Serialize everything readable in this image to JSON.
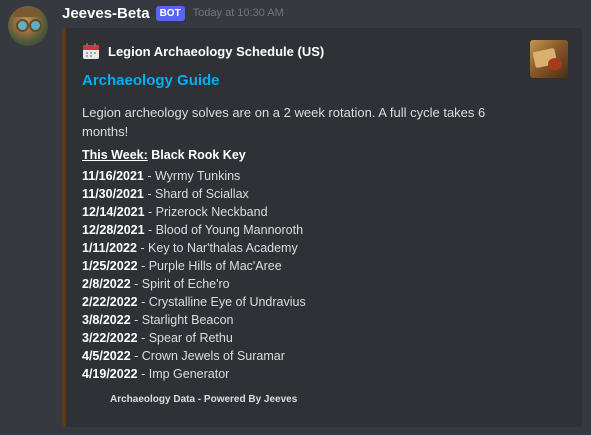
{
  "message": {
    "username": "Jeeves-Beta",
    "bot_tag": "BOT",
    "timestamp": "Today at 10:30 AM"
  },
  "embed": {
    "author_icon": "calendar-icon",
    "author_name": "Legion Archaeology Schedule (US)",
    "title": "Archaeology Guide",
    "description": "Legion archeology solves are on a 2 week rotation. A full cycle takes 6 months!",
    "this_week_label": "This Week:",
    "this_week_value": "Black Rook Key",
    "schedule": [
      {
        "date": "11/16/2021",
        "item": "Wyrmy Tunkins"
      },
      {
        "date": "11/30/2021",
        "item": "Shard of Sciallax"
      },
      {
        "date": "12/14/2021",
        "item": "Prizerock Neckband"
      },
      {
        "date": "12/28/2021",
        "item": "Blood of Young Mannoroth"
      },
      {
        "date": "1/11/2022",
        "item": "Key to Nar'thalas Academy"
      },
      {
        "date": "1/25/2022",
        "item": "Purple Hills of Mac'Aree"
      },
      {
        "date": "2/8/2022",
        "item": "Spirit of Eche'ro"
      },
      {
        "date": "2/22/2022",
        "item": "Crystalline Eye of Undravius"
      },
      {
        "date": "3/8/2022",
        "item": "Starlight Beacon"
      },
      {
        "date": "3/22/2022",
        "item": "Spear of Rethu"
      },
      {
        "date": "4/5/2022",
        "item": "Crown Jewels of Suramar"
      },
      {
        "date": "4/19/2022",
        "item": "Imp Generator"
      }
    ],
    "footer": "Archaeology Data - Powered By Jeeves",
    "accent_color": "#5c3a16"
  },
  "colors": {
    "background": "#36393f",
    "embed_background": "#2f3136",
    "link": "#00aff4",
    "bot_tag": "#5865f2"
  }
}
